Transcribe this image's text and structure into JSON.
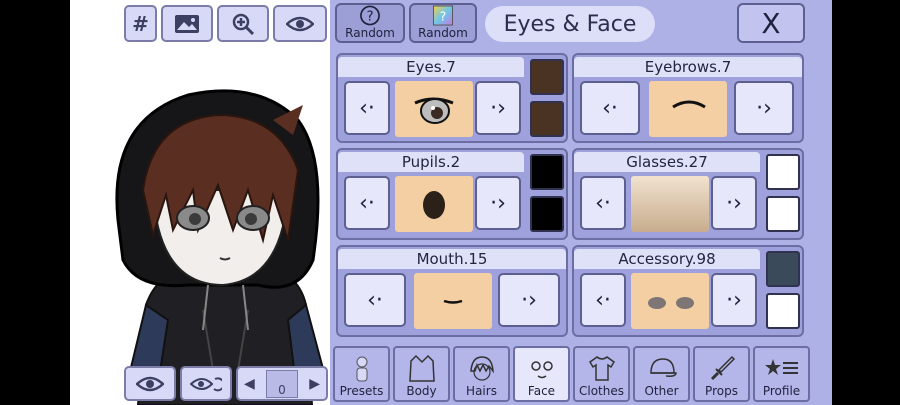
{
  "toolbar": {
    "grid_label": "#"
  },
  "panel": {
    "random_1": "Random",
    "random_2": "Random",
    "title": "Eyes & Face",
    "close": "X",
    "cards": {
      "eyes": "Eyes.7",
      "eyebrows": "Eyebrows.7",
      "pupils": "Pupils.2",
      "glasses": "Glasses.27",
      "mouth": "Mouth.15",
      "accessory": "Accessory.98"
    },
    "arrow_prev": "‹·",
    "arrow_next": "·›"
  },
  "bottom_left": {
    "slot_number": "0"
  },
  "tabs": [
    "Presets",
    "Body",
    "Hairs",
    "Face",
    "Clothes",
    "Other",
    "Props",
    "Profile"
  ],
  "colors": {
    "eye_color_1": "#4a3322",
    "eye_color_2": "#4a3322",
    "pupil_color_1": "#000000",
    "pupil_color_2": "#000000",
    "glasses_color_1": "#ffffff",
    "glasses_color_2": "#ffffff",
    "accessory_color_1": "#3a4a5a",
    "accessory_color_2": "#ffffff"
  }
}
